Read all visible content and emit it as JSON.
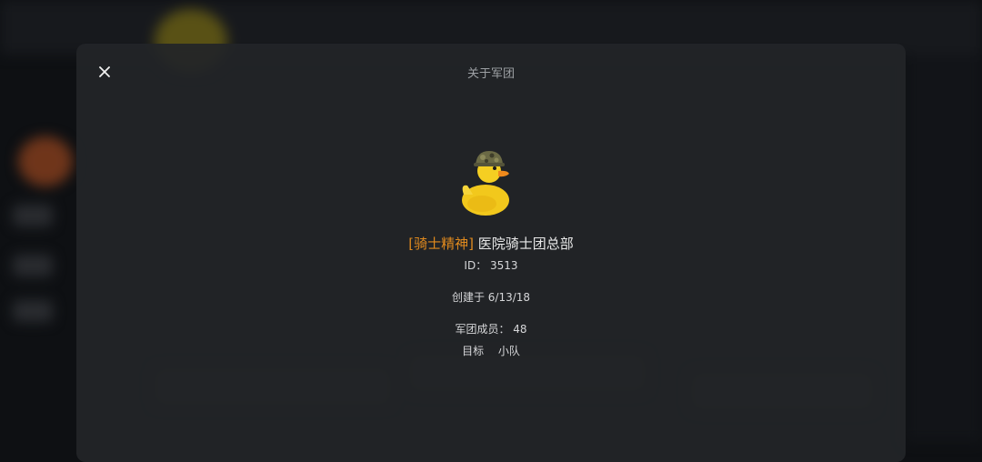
{
  "modal": {
    "title": "关于军团",
    "close_icon": "close-icon"
  },
  "legion": {
    "emblem_icon": "rubber-duck-soldier-icon",
    "tag": "[骑士精神]",
    "name": "医院骑士团总部",
    "id_label": "ID：",
    "id_value": "3513",
    "created_label": "创建于",
    "created_value": "6/13/18",
    "members_label": "军团成员：",
    "members_value": "48",
    "goal_label": "目标",
    "goal_value": "小队"
  },
  "colors": {
    "tag": "#e08a1e",
    "modal_bg": "#222528",
    "text": "#d6d7d9"
  }
}
